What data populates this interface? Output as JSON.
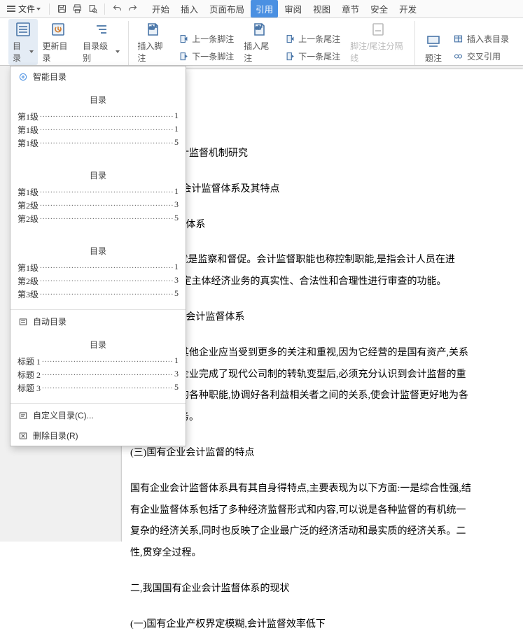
{
  "menubar": {
    "file_label": "文件",
    "tabs": [
      "开始",
      "插入",
      "页面布局",
      "引用",
      "审阅",
      "视图",
      "章节",
      "安全",
      "开发"
    ],
    "active_tab": "引用"
  },
  "ribbon": {
    "toc_group": {
      "toc": "目录",
      "update": "更新目录",
      "level": "目录级别"
    },
    "footnote_group": {
      "insert_footnote": "插入脚注",
      "prev_fn": "上一条脚注",
      "next_fn": "下一条脚注",
      "insert_endnote": "插入尾注",
      "prev_en": "上一条尾注",
      "next_en": "下一条尾注",
      "separator": "脚注/尾注分隔线"
    },
    "caption_group": {
      "caption": "题注",
      "insert_toc_table": "插入表目录",
      "cross_ref": "交叉引用"
    }
  },
  "dropdown": {
    "smart_toc": "智能目录",
    "auto_toc": "自动目录",
    "custom_toc": "自定义目录(C)...",
    "delete_toc": "删除目录(R)",
    "tp_title": "目录",
    "presets": {
      "p1": [
        {
          "label": "第1级",
          "page": "1",
          "indent": 0
        },
        {
          "label": "第1级",
          "page": "1",
          "indent": 0
        },
        {
          "label": "第1级",
          "page": "5",
          "indent": 0
        }
      ],
      "p2": [
        {
          "label": "第1级",
          "page": "1",
          "indent": 0
        },
        {
          "label": "第2级",
          "page": "3",
          "indent": 1
        },
        {
          "label": "第2级",
          "page": "5",
          "indent": 1
        }
      ],
      "p3": [
        {
          "label": "第1级",
          "page": "1",
          "indent": 0
        },
        {
          "label": "第2级",
          "page": "3",
          "indent": 1
        },
        {
          "label": "第3级",
          "page": "5",
          "indent": 2
        }
      ],
      "p4": [
        {
          "label": "标题 1",
          "page": "1",
          "indent": 0
        },
        {
          "label": "标题 2",
          "page": "3",
          "indent": 1
        },
        {
          "label": "标题 3",
          "page": "5",
          "indent": 2
        }
      ]
    }
  },
  "document": {
    "lines": [
      "国有企业会计监督机制研究",
      "一,国有企业会计监督体系及其特点",
      "(一)会计监督体系",
      "“监督”指的就是监察和督促。会计监督职能也称控制职能,是指会计人员在进",
      "的同时,对特定主体经济业务的真实性、合法性和合理性进行审查的功能。",
      "(二)国有企业会计监督体系",
      "国有企业比其他企业应当受到更多的关注和重视,因为它经营的是国有资产,关系",
      "益。在国有企业完成了现代公司制的转轨变型后,必须充分认识到会计监督的重",
      "挥会计监督的各种职能,协调好各利益相关者之间的关系,使会计监督更好地为各",
      "者的利益服务。",
      "(三)国有企业会计监督的特点",
      "国有企业会计监督体系具有其自身得特点,主要表现为以下方面:一是综合性强,结",
      "有企业监督体系包括了多种经济监督形式和内容,可以说是各种监督的有机统一",
      "复杂的经济关系,同时也反映了企业最广泛的经济活动和最实质的经济关系。二",
      "性,贯穿全过程。",
      "二,我国国有企业会计监督体系的现状",
      "(一)国有企业产权界定模糊,会计监督效率低下"
    ]
  }
}
